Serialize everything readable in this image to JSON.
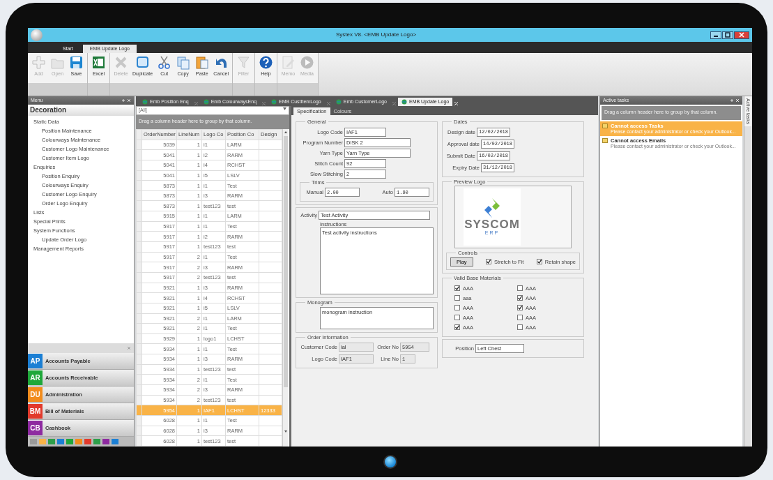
{
  "window": {
    "title": "Systex V8. <EMB Update Logo>"
  },
  "ribbon_tabs": [
    {
      "label": "Start",
      "selected": false
    },
    {
      "label": "EMB Update Logo",
      "selected": true
    }
  ],
  "toolbar_groups": [
    [
      {
        "label": "Add",
        "kind": "plus",
        "disabled": true
      },
      {
        "label": "Open",
        "kind": "folder",
        "disabled": true
      },
      {
        "label": "Save",
        "kind": "disk",
        "disabled": false
      }
    ],
    [
      {
        "label": "Excel",
        "kind": "excel",
        "disabled": false
      }
    ],
    [
      {
        "label": "Delete",
        "kind": "cross",
        "disabled": true
      },
      {
        "label": "Duplicate",
        "kind": "duplicate",
        "disabled": false
      },
      {
        "label": "Cut",
        "kind": "scissors",
        "disabled": false
      },
      {
        "label": "Copy",
        "kind": "copy",
        "disabled": false
      },
      {
        "label": "Paste",
        "kind": "paste",
        "disabled": false
      },
      {
        "label": "Cancel",
        "kind": "undo",
        "disabled": false
      }
    ],
    [
      {
        "label": "Filter",
        "kind": "funnel",
        "disabled": true
      }
    ],
    [
      {
        "label": "Help",
        "kind": "help",
        "disabled": false
      }
    ],
    [
      {
        "label": "Memo",
        "kind": "pencil",
        "disabled": true
      },
      {
        "label": "Media",
        "kind": "play",
        "disabled": true
      }
    ]
  ],
  "menu": {
    "title": "Menu",
    "heading": "Decoration",
    "items": [
      {
        "label": "Static Data",
        "children": [
          {
            "label": "Position Maintenance"
          },
          {
            "label": "Colourways Maintenance"
          },
          {
            "label": "Customer Logo Maintenance"
          },
          {
            "label": "Customer Item Logo"
          }
        ]
      },
      {
        "label": "Enquiries",
        "children": [
          {
            "label": "Position Enquiry"
          },
          {
            "label": "Colourways Enquiry"
          },
          {
            "label": "Customer Logo Enquiry"
          },
          {
            "label": "Order Logo Enquiry"
          }
        ]
      },
      {
        "label": "Lists"
      },
      {
        "label": "Special Prints"
      },
      {
        "label": "System Functions",
        "children": [
          {
            "label": "Update Order Logo"
          }
        ]
      },
      {
        "label": "Management Reports"
      }
    ]
  },
  "modules": [
    {
      "code": "AP",
      "label": "Accounts Payable",
      "color": "#1b7fd4"
    },
    {
      "code": "AR",
      "label": "Accounts Receivable",
      "color": "#1fa83a"
    },
    {
      "code": "DU",
      "label": "Administration",
      "color": "#f28c1c"
    },
    {
      "code": "BM",
      "label": "Bill of Materials",
      "color": "#e23a2c"
    },
    {
      "code": "CB",
      "label": "Cashbook",
      "color": "#8e2aa0"
    }
  ],
  "document_tabs": [
    {
      "label": "Emb Position Enq",
      "selected": false
    },
    {
      "label": "Emb ColourwaysEnq",
      "selected": false
    },
    {
      "label": "EMB CustItemLogo",
      "selected": false
    },
    {
      "label": "Emb CustomerLogo",
      "selected": false
    },
    {
      "label": "EMB Update Logo",
      "selected": true
    }
  ],
  "grid": {
    "filter": "[All]",
    "group_hint": "Drag a column header here to group by that column.",
    "columns": [
      "OrderNumber",
      "LineNum",
      "Logo Co",
      "Position Co",
      "Design"
    ],
    "rows": [
      {
        "cells": [
          "5039",
          "1",
          "i1",
          "LARM",
          ""
        ],
        "selected": false
      },
      {
        "cells": [
          "5041",
          "1",
          "i2",
          "RARM",
          ""
        ],
        "selected": false
      },
      {
        "cells": [
          "5041",
          "1",
          "i4",
          "RCHST",
          ""
        ],
        "selected": false
      },
      {
        "cells": [
          "5041",
          "1",
          "i5",
          "LSLV",
          ""
        ],
        "selected": false
      },
      {
        "cells": [
          "5873",
          "1",
          "i1",
          "Test",
          ""
        ],
        "selected": false
      },
      {
        "cells": [
          "5873",
          "1",
          "i3",
          "RARM",
          ""
        ],
        "selected": false
      },
      {
        "cells": [
          "5873",
          "1",
          "test123",
          "test",
          ""
        ],
        "selected": false
      },
      {
        "cells": [
          "5915",
          "1",
          "i1",
          "LARM",
          ""
        ],
        "selected": false
      },
      {
        "cells": [
          "5917",
          "1",
          "i1",
          "Test",
          ""
        ],
        "selected": false
      },
      {
        "cells": [
          "5917",
          "1",
          "i2",
          "RARM",
          ""
        ],
        "selected": false
      },
      {
        "cells": [
          "5917",
          "1",
          "test123",
          "test",
          ""
        ],
        "selected": false
      },
      {
        "cells": [
          "5917",
          "2",
          "i1",
          "Test",
          ""
        ],
        "selected": false
      },
      {
        "cells": [
          "5917",
          "2",
          "i3",
          "RARM",
          ""
        ],
        "selected": false
      },
      {
        "cells": [
          "5917",
          "2",
          "test123",
          "test",
          ""
        ],
        "selected": false
      },
      {
        "cells": [
          "5921",
          "1",
          "i3",
          "RARM",
          ""
        ],
        "selected": false
      },
      {
        "cells": [
          "5921",
          "1",
          "i4",
          "RCHST",
          ""
        ],
        "selected": false
      },
      {
        "cells": [
          "5921",
          "1",
          "i5",
          "LSLV",
          ""
        ],
        "selected": false
      },
      {
        "cells": [
          "5921",
          "2",
          "i1",
          "LARM",
          ""
        ],
        "selected": false
      },
      {
        "cells": [
          "5921",
          "2",
          "i1",
          "Test",
          ""
        ],
        "selected": false
      },
      {
        "cells": [
          "5929",
          "1",
          "logo1",
          "LCHST",
          ""
        ],
        "selected": false
      },
      {
        "cells": [
          "5934",
          "1",
          "i1",
          "Test",
          ""
        ],
        "selected": false
      },
      {
        "cells": [
          "5934",
          "1",
          "i3",
          "RARM",
          ""
        ],
        "selected": false
      },
      {
        "cells": [
          "5934",
          "1",
          "test123",
          "test",
          ""
        ],
        "selected": false
      },
      {
        "cells": [
          "5934",
          "2",
          "i1",
          "Test",
          ""
        ],
        "selected": false
      },
      {
        "cells": [
          "5934",
          "2",
          "i3",
          "RARM",
          ""
        ],
        "selected": false
      },
      {
        "cells": [
          "5934",
          "2",
          "test123",
          "test",
          ""
        ],
        "selected": false
      },
      {
        "cells": [
          "5954",
          "1",
          "IAF1",
          "LCHST",
          "12333"
        ],
        "selected": true
      },
      {
        "cells": [
          "6028",
          "1",
          "i1",
          "Test",
          ""
        ],
        "selected": false
      },
      {
        "cells": [
          "6028",
          "1",
          "i3",
          "RARM",
          ""
        ],
        "selected": false
      },
      {
        "cells": [
          "6028",
          "1",
          "test123",
          "test",
          ""
        ],
        "selected": false
      }
    ]
  },
  "form": {
    "tabs": [
      {
        "label": "Specification",
        "selected": true
      },
      {
        "label": "Colours",
        "selected": false
      }
    ],
    "general": {
      "title": "General",
      "fields": [
        {
          "label": "Logo Code",
          "value": "IAF1"
        },
        {
          "label": "Program Number",
          "value": "DISK 2"
        },
        {
          "label": "Yarn Type",
          "value": "Yarn Type"
        },
        {
          "label": "Stitch Count",
          "value": "92"
        },
        {
          "label": "Slow Stitching",
          "value": "2"
        }
      ],
      "trims": {
        "title": "Trims",
        "fields": [
          {
            "label": "Manual",
            "value": "2.00"
          },
          {
            "label": "Auto",
            "value": "1.90"
          }
        ]
      }
    },
    "activity": {
      "label": "Activity",
      "value": "Test Activity",
      "instructions_label": "Instructions",
      "instructions": "Test activity instructions"
    },
    "monogram": {
      "title": "Monogram",
      "value": "monogram instruction"
    },
    "order_information": {
      "title": "Order Information",
      "fields": [
        {
          "label": "Customer Code",
          "value": "ial"
        },
        {
          "label": "Order No",
          "value": "5954"
        },
        {
          "label": "Logo Code",
          "value": "IAF1"
        },
        {
          "label": "Line No",
          "value": "1"
        }
      ]
    },
    "dates": {
      "title": "Dates",
      "fields": [
        {
          "label": "Design date",
          "value": "12/02/2018"
        },
        {
          "label": "Approval date",
          "value": "14/02/2018"
        },
        {
          "label": "Submit Date",
          "value": "16/02/2018"
        },
        {
          "label": "Expiry Date",
          "value": "31/12/2018"
        }
      ]
    },
    "preview": {
      "title": "Preview Logo",
      "logo_text": "SYSCOM",
      "logo_subtext": "ERP",
      "controls_title": "Controls",
      "play": "Play",
      "options": [
        {
          "label": "Stretch to Fit",
          "checked": true
        },
        {
          "label": "Retain shape",
          "checked": true
        }
      ]
    },
    "materials": {
      "title": "Valid Base Materials",
      "items": [
        {
          "label": "AAA",
          "checked": true
        },
        {
          "label": "AAA",
          "checked": false
        },
        {
          "label": "aaa",
          "checked": false
        },
        {
          "label": "AAA",
          "checked": true
        },
        {
          "label": "AAA",
          "checked": false
        },
        {
          "label": "AAA",
          "checked": true
        },
        {
          "label": "AAA",
          "checked": false
        },
        {
          "label": "AAA",
          "checked": false
        },
        {
          "label": "AAA",
          "checked": true
        },
        {
          "label": "AAA",
          "checked": false
        }
      ]
    },
    "position": {
      "label": "Position",
      "value": "Left Chest"
    }
  },
  "active_tasks": {
    "title": "Active tasks",
    "group_hint": "Drag a column header here to group by that column.",
    "side_tab": "Active tasks",
    "tasks": [
      {
        "title": "Cannot access Tasks",
        "detail": "Please contact your administrator or check your Outlook...",
        "selected": true
      },
      {
        "title": "Cannot access Emails",
        "detail": "Please contact your administrator or check your Outlook...",
        "selected": false
      }
    ]
  }
}
